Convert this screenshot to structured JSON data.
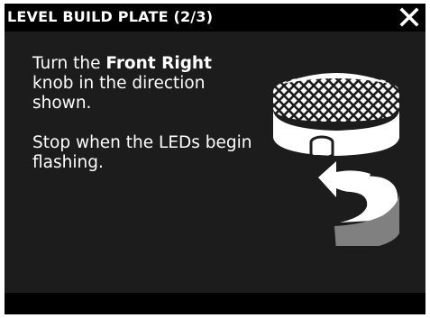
{
  "header": {
    "title": "LEVEL BUILD PLATE (2/3)",
    "close_icon": "close-icon"
  },
  "instructions": {
    "line1_prefix": "Turn the ",
    "line1_bold": "Front Right",
    "line1_suffix": " knob in the direction shown.",
    "line2": "Stop when the LEDs begin flashing."
  },
  "illustration": {
    "icon": "leveling-knob-rotate-icon"
  },
  "colors": {
    "header_bg": "#000000",
    "content_bg": "#1c1c1c",
    "text": "#ffffff",
    "arrow_dark": "#808080"
  }
}
